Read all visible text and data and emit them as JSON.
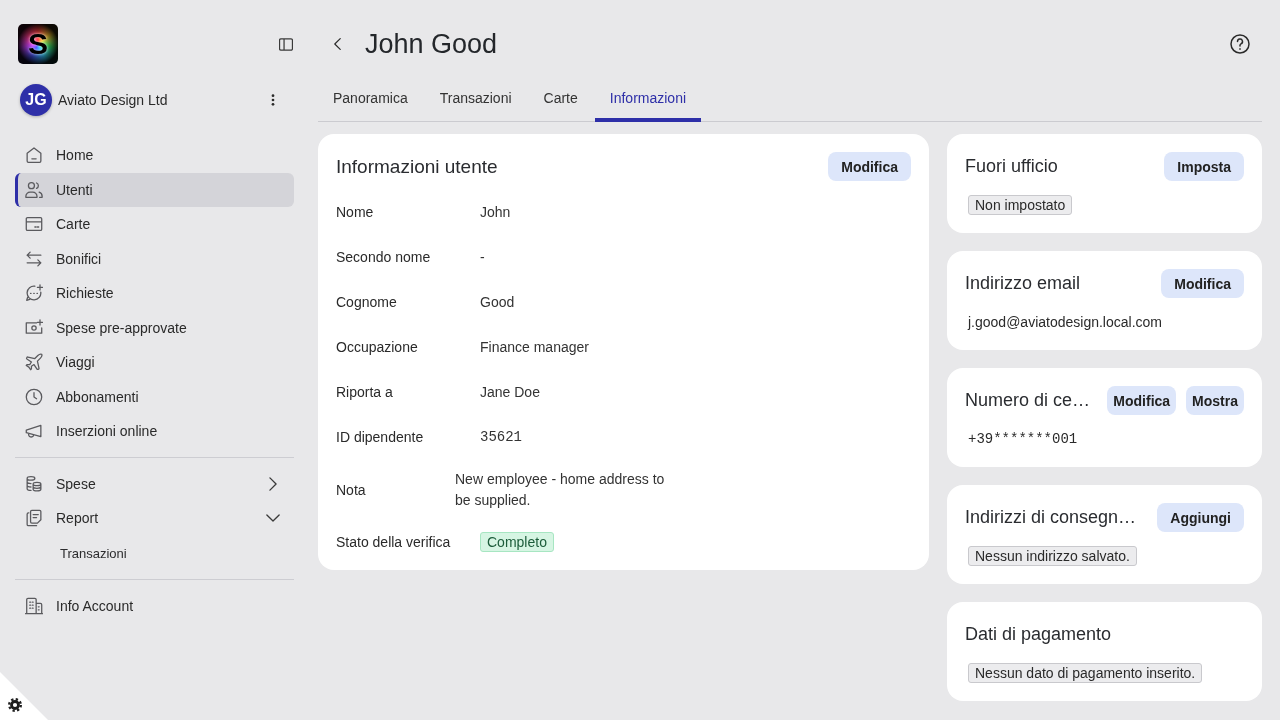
{
  "sidebar": {
    "logo": "S",
    "organization": {
      "initials": "JG",
      "name": "Aviato Design Ltd"
    },
    "nav_sections": [
      {
        "items": [
          {
            "label": "Home",
            "selected": false
          },
          {
            "label": "Utenti",
            "selected": true
          },
          {
            "label": "Carte",
            "selected": false
          },
          {
            "label": "Bonifici",
            "selected": false
          },
          {
            "label": "Richieste",
            "selected": false
          },
          {
            "label": "Spese pre-approvate",
            "selected": false
          },
          {
            "label": "Viaggi",
            "selected": false
          },
          {
            "label": "Abbonamenti",
            "selected": false
          },
          {
            "label": "Inserzioni online",
            "selected": false
          }
        ]
      },
      {
        "items": [
          {
            "label": "Spese",
            "selected": false,
            "expanded": false
          },
          {
            "label": "Report",
            "selected": false,
            "expanded": true,
            "children": [
              {
                "label": "Transazioni",
                "selected": false
              }
            ]
          }
        ]
      },
      {
        "items": [
          {
            "label": "Info Account",
            "selected": false
          }
        ]
      }
    ]
  },
  "header": {
    "title": "John Good"
  },
  "tabs": [
    {
      "label": "Panoramica",
      "selected": false
    },
    {
      "label": "Transazioni",
      "selected": false
    },
    {
      "label": "Carte",
      "selected": false
    },
    {
      "label": "Informazioni",
      "selected": true
    }
  ],
  "user_info": {
    "title": "Informazioni utente",
    "button": "Modifica",
    "rows": [
      {
        "label": "Nome",
        "value": "John",
        "kind": "text"
      },
      {
        "label": "Secondo nome",
        "value": "-",
        "kind": "text"
      },
      {
        "label": "Cognome",
        "value": "Good",
        "kind": "text"
      },
      {
        "label": "Occupazione",
        "value": "Finance manager",
        "kind": "text"
      },
      {
        "label": "Riporta a",
        "value": "Jane Doe",
        "kind": "text"
      },
      {
        "label": "ID dipendente",
        "value": "35621",
        "kind": "mono"
      },
      {
        "label": "Nota",
        "value": "New employee - home address to be supplied.",
        "kind": "note"
      },
      {
        "label": "Stato della verifica",
        "value": "Completo",
        "kind": "status"
      }
    ]
  },
  "side_cards": [
    {
      "title": "Fuori ufficio",
      "buttons": [
        "Imposta"
      ],
      "content": {
        "kind": "tag",
        "text": "Non impostato"
      }
    },
    {
      "title": "Indirizzo email",
      "buttons": [
        "Modifica"
      ],
      "content": {
        "kind": "text",
        "text": "j.good@aviatodesign.local.com"
      }
    },
    {
      "title": "Numero di ce…",
      "buttons": [
        "Modifica",
        "Mostra"
      ],
      "content": {
        "kind": "mono",
        "text": "+39*******001"
      }
    },
    {
      "title": "Indirizzi di consegn…",
      "buttons": [
        "Aggiungi"
      ],
      "content": {
        "kind": "tag",
        "text": "Nessun indirizzo salvato."
      }
    },
    {
      "title": "Dati di pagamento",
      "content": {
        "kind": "tag",
        "text": "Nessun dato di pagamento inserito."
      }
    }
  ]
}
